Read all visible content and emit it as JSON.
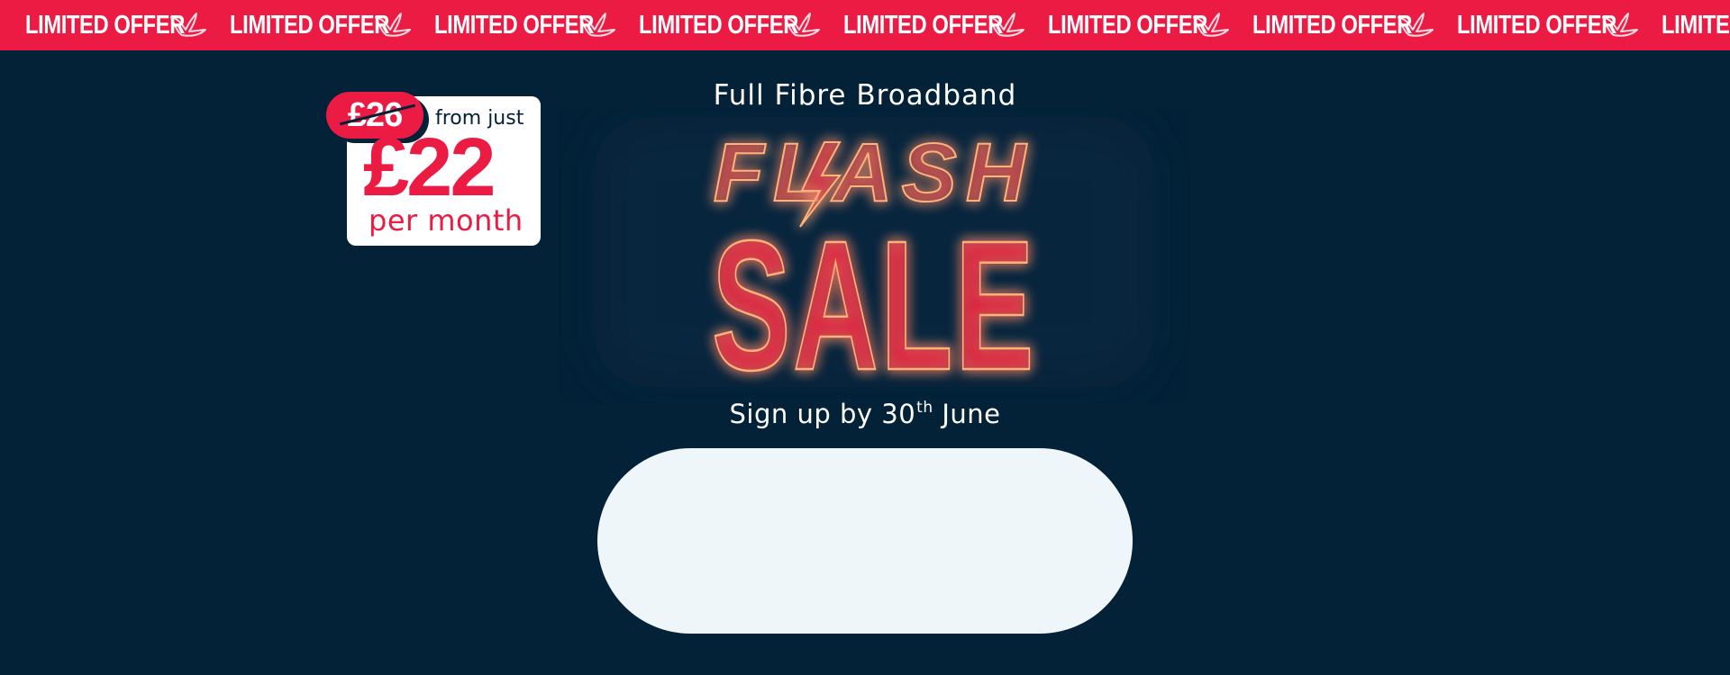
{
  "ticker": {
    "label": "LIMITED OFFER",
    "icon": "bird-icon",
    "repeat_count": 9
  },
  "price_badge": {
    "old_price": "£26",
    "from_text": "from just",
    "new_price": "£22",
    "period": "per month"
  },
  "headline": "Full Fibre Broadband",
  "sale": {
    "line1": "FLASH",
    "line2": "SALE"
  },
  "signup": {
    "prefix": "Sign up by 30",
    "suffix": "th",
    "month": "June"
  },
  "colors": {
    "background": "#032137",
    "accent": "#ec1b44",
    "neon_outline": "#ffb27a",
    "pill": "#eef6f9"
  }
}
